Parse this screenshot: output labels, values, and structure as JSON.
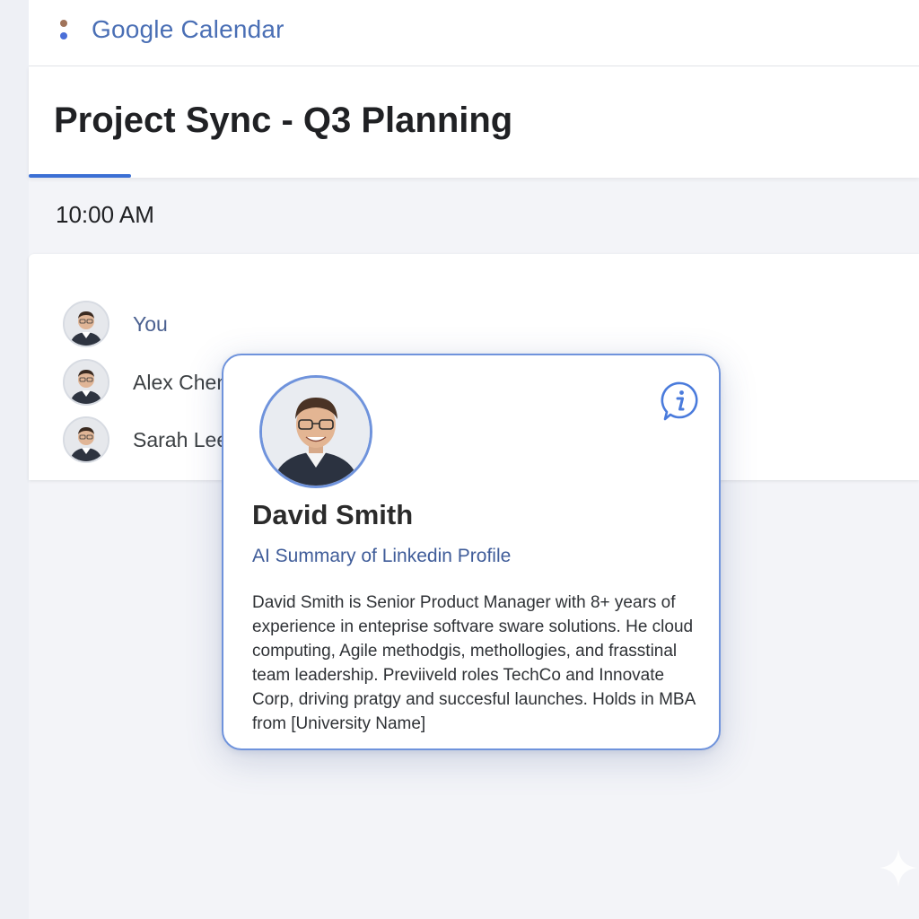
{
  "app": {
    "name_part1": "Google",
    "name_part2": " Calendar",
    "logo_colors": [
      "#a0735a",
      "#4a6fd8"
    ]
  },
  "event": {
    "title": "Project Sync - Q3 Planning",
    "time": "10:00 AM"
  },
  "guests": [
    {
      "name": "You"
    },
    {
      "name": "Alex Chen"
    },
    {
      "name": "Sarah Lee"
    }
  ],
  "profile_popover": {
    "name": "David Smith",
    "subtitle": "AI Summary of Linkedin Profile",
    "summary": "David Smith is Senior Product Manager with 8+ years of experience in enteprise softvare sware solutions. He cloud computing, Agile methodgis, methollogies, and frasstinal team leadership. Previiveld roles TechCo and Innovate Corp, driving pratgy and succesful launches. Holds in MBA from [University Name]",
    "info_icon": "info-bubble-icon"
  },
  "colors": {
    "accent": "#3b6fd4",
    "popover_border": "#6f93dc",
    "link_text": "#3f5c99"
  }
}
